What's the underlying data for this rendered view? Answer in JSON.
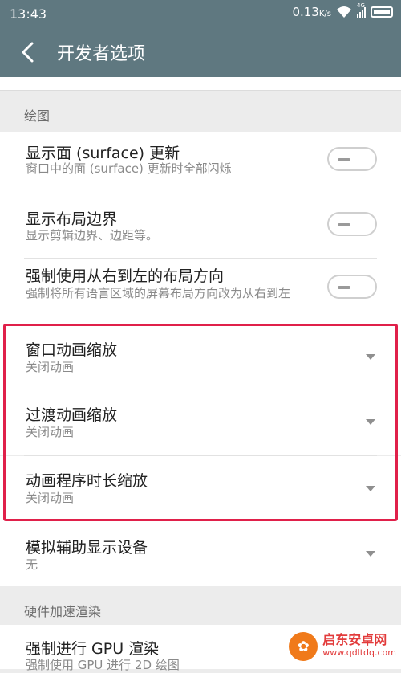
{
  "status_bar": {
    "time": "13:43",
    "network_speed": "0.13",
    "speed_unit": "K/s",
    "network_type": "4G"
  },
  "app_bar": {
    "title": "开发者选项"
  },
  "sections": {
    "drawing": "绘图",
    "hardware": "硬件加速渲染"
  },
  "items": [
    {
      "title": "显示面 (surface) 更新",
      "subtitle": "窗口中的面 (surface) 更新时全部闪烁",
      "control": "toggle",
      "checked": false
    },
    {
      "title": "显示布局边界",
      "subtitle": "显示剪辑边界、边距等。",
      "control": "toggle",
      "checked": false
    },
    {
      "title": "强制使用从右到左的布局方向",
      "subtitle": "强制将所有语言区域的屏幕布局方向改为从右到左",
      "control": "toggle",
      "checked": false
    },
    {
      "title": "窗口动画缩放",
      "subtitle": "关闭动画",
      "control": "dropdown"
    },
    {
      "title": "过渡动画缩放",
      "subtitle": "关闭动画",
      "control": "dropdown"
    },
    {
      "title": "动画程序时长缩放",
      "subtitle": "关闭动画",
      "control": "dropdown"
    },
    {
      "title": "模拟辅助显示设备",
      "subtitle": "无",
      "control": "dropdown"
    },
    {
      "title": "强制进行 GPU 渲染",
      "subtitle": "强制使用 GPU 进行 2D 绘图"
    }
  ],
  "watermark": {
    "name": "启东安卓网",
    "url": "www.qdltdq.com"
  },
  "colors": {
    "app_bar": "#5f7880",
    "highlight": "#e0204a",
    "background": "#ececec"
  }
}
